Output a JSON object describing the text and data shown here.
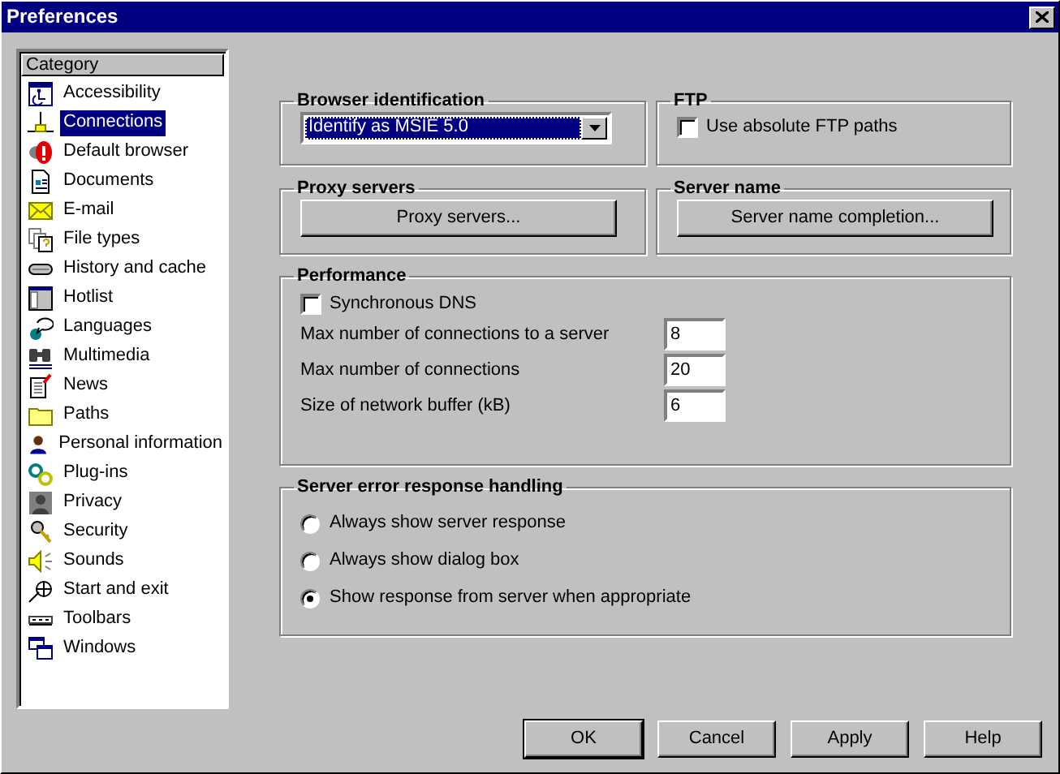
{
  "window": {
    "title": "Preferences"
  },
  "categories": {
    "header": "Category",
    "items": [
      {
        "label": "Accessibility",
        "selected": false
      },
      {
        "label": "Connections",
        "selected": true
      },
      {
        "label": "Default browser",
        "selected": false
      },
      {
        "label": "Documents",
        "selected": false
      },
      {
        "label": "E-mail",
        "selected": false
      },
      {
        "label": "File types",
        "selected": false
      },
      {
        "label": "History and cache",
        "selected": false
      },
      {
        "label": "Hotlist",
        "selected": false
      },
      {
        "label": "Languages",
        "selected": false
      },
      {
        "label": "Multimedia",
        "selected": false
      },
      {
        "label": "News",
        "selected": false
      },
      {
        "label": "Paths",
        "selected": false
      },
      {
        "label": "Personal information",
        "selected": false
      },
      {
        "label": "Plug-ins",
        "selected": false
      },
      {
        "label": "Privacy",
        "selected": false
      },
      {
        "label": "Security",
        "selected": false
      },
      {
        "label": "Sounds",
        "selected": false
      },
      {
        "label": "Start and exit",
        "selected": false
      },
      {
        "label": "Toolbars",
        "selected": false
      },
      {
        "label": "Windows",
        "selected": false
      }
    ]
  },
  "browser_identification": {
    "title": "Browser identification",
    "value": "Identify as MSIE 5.0"
  },
  "ftp": {
    "title": "FTP",
    "checkbox": {
      "label": "Use absolute FTP paths",
      "checked": false
    }
  },
  "proxy_servers": {
    "title": "Proxy servers",
    "button": "Proxy servers..."
  },
  "server_name": {
    "title": "Server name",
    "button": "Server name completion..."
  },
  "performance": {
    "title": "Performance",
    "checkbox": {
      "label": "Synchronous DNS",
      "checked": false
    },
    "fields": [
      {
        "label": "Max number of connections to a server",
        "value": "8"
      },
      {
        "label": "Max number of connections",
        "value": "20"
      },
      {
        "label": "Size of network buffer (kB)",
        "value": "6"
      }
    ]
  },
  "server_error": {
    "title": "Server error response handling",
    "options": [
      {
        "label": "Always show server response",
        "selected": false
      },
      {
        "label": "Always show dialog box",
        "selected": false
      },
      {
        "label": "Show response from server when appropriate",
        "selected": true
      }
    ]
  },
  "buttons": [
    {
      "label": "OK",
      "default": true
    },
    {
      "label": "Cancel",
      "default": false
    },
    {
      "label": "Apply",
      "default": false
    },
    {
      "label": "Help",
      "default": false
    }
  ]
}
